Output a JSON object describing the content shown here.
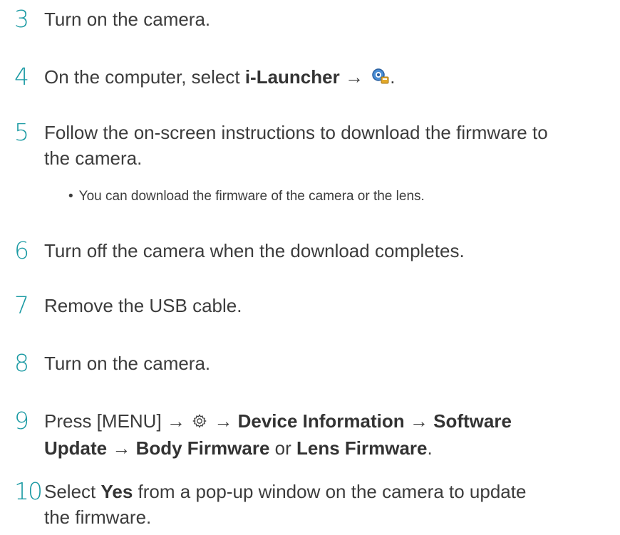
{
  "steps": [
    {
      "num": "3",
      "text": "Turn on the camera."
    },
    {
      "num": "4",
      "prefix": "On the computer, select ",
      "bold": "i-Launcher",
      "arrow": " → ",
      "icon": "i-launcher-icon",
      "suffix": "."
    },
    {
      "num": "5",
      "line1": "Follow the on-screen instructions to download the firmware to",
      "line2": "the camera.",
      "bullet": "You can download the firmware of the camera or the lens."
    },
    {
      "num": "6",
      "text": "Turn off the camera when the download completes."
    },
    {
      "num": "7",
      "text": "Remove the USB cable."
    },
    {
      "num": "8",
      "text": "Turn on the camera."
    },
    {
      "num": "9",
      "press": "Press [MENU] → ",
      "gear_icon": "gear-icon",
      "arrow1": " → ",
      "b1": "Device Information",
      "arrow2": " → ",
      "b2": "Software",
      "b3": "Update",
      "arrow3": " → ",
      "b4": "Body Firmware",
      "or": " or ",
      "b5": "Lens Firmware",
      "end": "."
    },
    {
      "num": "10",
      "select": "Select ",
      "bold": "Yes",
      "rest1": " from a pop-up window on the camera to update",
      "line2": "the firmware."
    }
  ],
  "colors": {
    "step_number": "#1a9aa3",
    "body_text": "#3c3c3c"
  }
}
